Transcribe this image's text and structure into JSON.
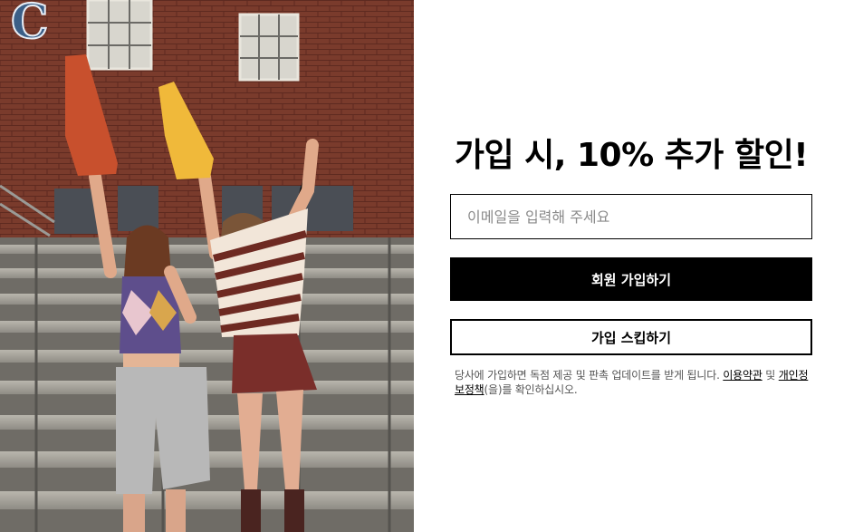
{
  "hero": {
    "image_alt": "Two women cheering with foam fingers in stadium bleachers",
    "banner_letter": "C"
  },
  "signup": {
    "headline": "가입 시, 10% 추가 할인!",
    "email_placeholder": "이메일을 입력해 주세요",
    "email_value": "",
    "signup_button": "회원 가입하기",
    "skip_button": "가입 스킵하기",
    "disclaimer": {
      "text_before": "당사에 가입하면 독점 제공 및 판촉 업데이트를 받게 됩니다. ",
      "terms_link": "이용약관",
      "text_middle": " 및 ",
      "privacy_link": "개인정보정책",
      "text_after": "(을)를 확인하십시오."
    }
  },
  "colors": {
    "primary_button_bg": "#000000",
    "primary_button_text": "#ffffff",
    "border": "#000000",
    "placeholder": "#8a8a8a",
    "disclaimer_text": "#555555"
  }
}
